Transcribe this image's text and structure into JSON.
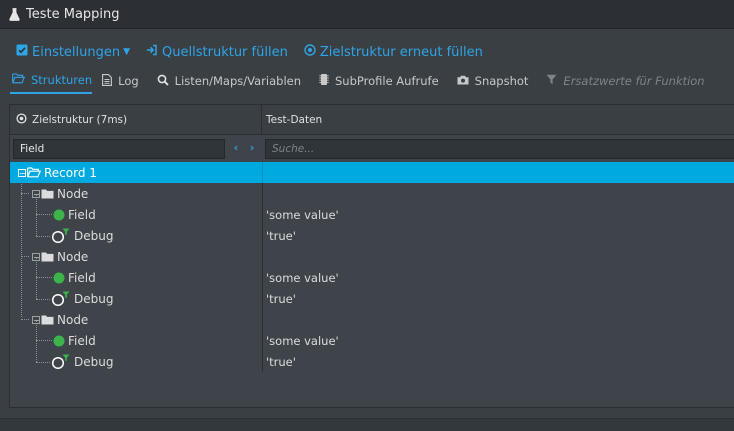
{
  "window": {
    "title": "Teste Mapping"
  },
  "toolbar": {
    "settings_label": "Einstellungen",
    "fill_source_label": "Quellstruktur füllen",
    "refill_target_label": "Zielstruktur erneut füllen"
  },
  "tabs": [
    {
      "label": "Strukturen",
      "active": true
    },
    {
      "label": "Log"
    },
    {
      "label": "Listen/Maps/Variablen"
    },
    {
      "label": "SubProfile Aufrufe"
    },
    {
      "label": "Snapshot"
    },
    {
      "label": "Ersatzwerte für Funktion",
      "disabled": true
    }
  ],
  "columns": {
    "target_header": "Zielstruktur (7ms)",
    "test_data_header": "Test-Daten"
  },
  "filter": {
    "field_value": "Field",
    "search_placeholder": "Suche..."
  },
  "tree": {
    "root_label": "Record 1",
    "rows": [
      {
        "label": "Node",
        "value": ""
      },
      {
        "label": "Field",
        "value": "'some value'"
      },
      {
        "label": "Debug",
        "value": "'true'"
      },
      {
        "label": "Node",
        "value": ""
      },
      {
        "label": "Field",
        "value": "'some value'"
      },
      {
        "label": "Debug",
        "value": "'true'"
      },
      {
        "label": "Node",
        "value": ""
      },
      {
        "label": "Field",
        "value": "'some value'"
      },
      {
        "label": "Debug",
        "value": "'true'"
      }
    ]
  },
  "colors": {
    "accent": "#2fa4e7",
    "selection": "#00a9df",
    "green": "#3cb44b"
  }
}
